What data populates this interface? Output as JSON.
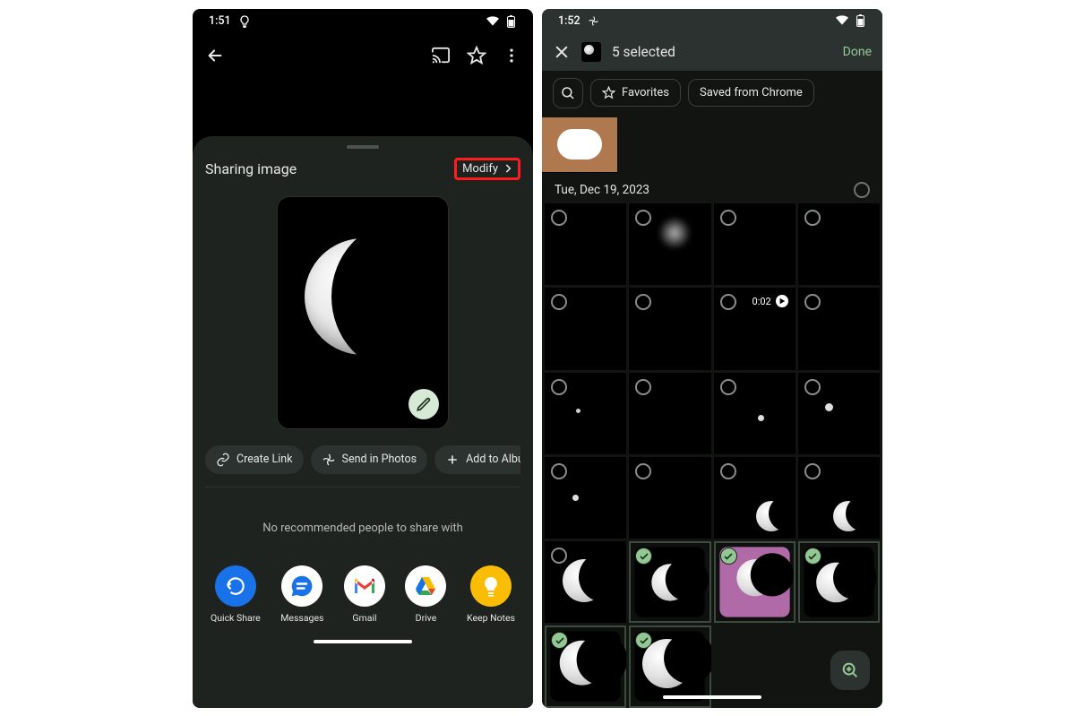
{
  "left": {
    "statusbar": {
      "time": "1:51"
    },
    "sheet": {
      "title": "Sharing image",
      "modify": "Modify",
      "chips": {
        "create_link": "Create Link",
        "send_photos": "Send in Photos",
        "add_album": "Add to Album"
      },
      "no_rec": "No recommended people to share with"
    },
    "apps": {
      "quick_share": "Quick Share",
      "messages": "Messages",
      "gmail": "Gmail",
      "drive": "Drive",
      "keep": "Keep Notes"
    }
  },
  "right": {
    "statusbar": {
      "time": "1:52"
    },
    "topbar": {
      "selected": "5 selected",
      "done": "Done"
    },
    "filters": {
      "favorites": "Favorites",
      "saved": "Saved from Chrome"
    },
    "date": "Tue, Dec 19, 2023",
    "video_badge": "0:02"
  }
}
